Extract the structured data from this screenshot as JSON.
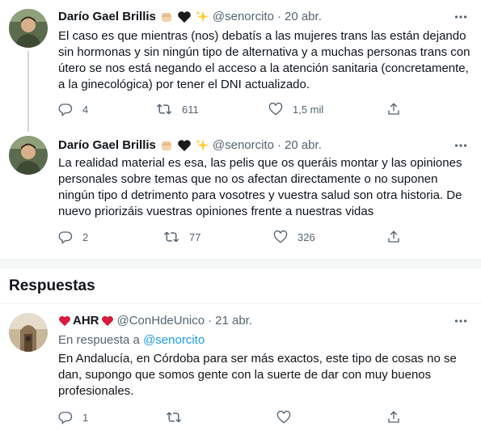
{
  "thread": [
    {
      "author": {
        "name": "Darío Gael Brillis",
        "handle": "@senorcito",
        "date": "20 abr."
      },
      "text_lines": [
        "El caso es que mientras (nos) debatís a las mujeres trans las están dejando",
        "sin hormonas y sin ningún tipo de alternativa y a muchas personas trans con",
        "útero se nos está negando el acceso a la atención sanitaria (concretamente,",
        "a la ginecológica) por tener el DNI actualizado."
      ],
      "stats": {
        "replies": "4",
        "retweets": "611",
        "likes": "1,5 mil"
      }
    },
    {
      "author": {
        "name": "Darío Gael Brillis",
        "handle": "@senorcito",
        "date": "20 abr."
      },
      "text_lines": [
        "La realidad material es esa, las pelis que os queráis montar y las opiniones",
        "personales sobre temas que no os afectan directamente o no suponen",
        "ningún tipo d detrimento para vosotres y vuestra salud son otra historia. De",
        "nuevo priorizáis vuestras opiniones frente a nuestras vidas"
      ],
      "stats": {
        "replies": "2",
        "retweets": "77",
        "likes": "326"
      }
    }
  ],
  "replies_section": {
    "title": "Respuestas"
  },
  "reply": {
    "author": {
      "name": "AHR",
      "handle": "@ConHdeUnico",
      "date": "21 abr."
    },
    "reply_to_prefix": "En respuesta a",
    "reply_to_handle": "@senorcito",
    "text_lines": [
      "En Andalucía, en Córdoba para ser más exactos, este tipo de cosas no se",
      "dan, supongo que somos gente con la suerte de dar con muy buenos",
      "profesionales."
    ],
    "stats": {
      "replies": "1",
      "retweets": "",
      "likes": ""
    }
  },
  "symbols": {
    "separator": "·"
  },
  "icons": {
    "author_badges": [
      "raised-fist-icon",
      "black-heart-icon",
      "sparkles-icon"
    ],
    "reply_name_hearts": [
      "red-heart-icon",
      "red-heart-icon"
    ],
    "actions": [
      "reply-icon",
      "retweet-icon",
      "like-icon",
      "share-icon"
    ],
    "more": "more-options-icon"
  },
  "colors": {
    "text_primary": "#0f1419",
    "text_secondary": "#536471",
    "link": "#1d9bf0",
    "thread_line": "#cfd9de",
    "heart_red": "#d81b3c"
  }
}
